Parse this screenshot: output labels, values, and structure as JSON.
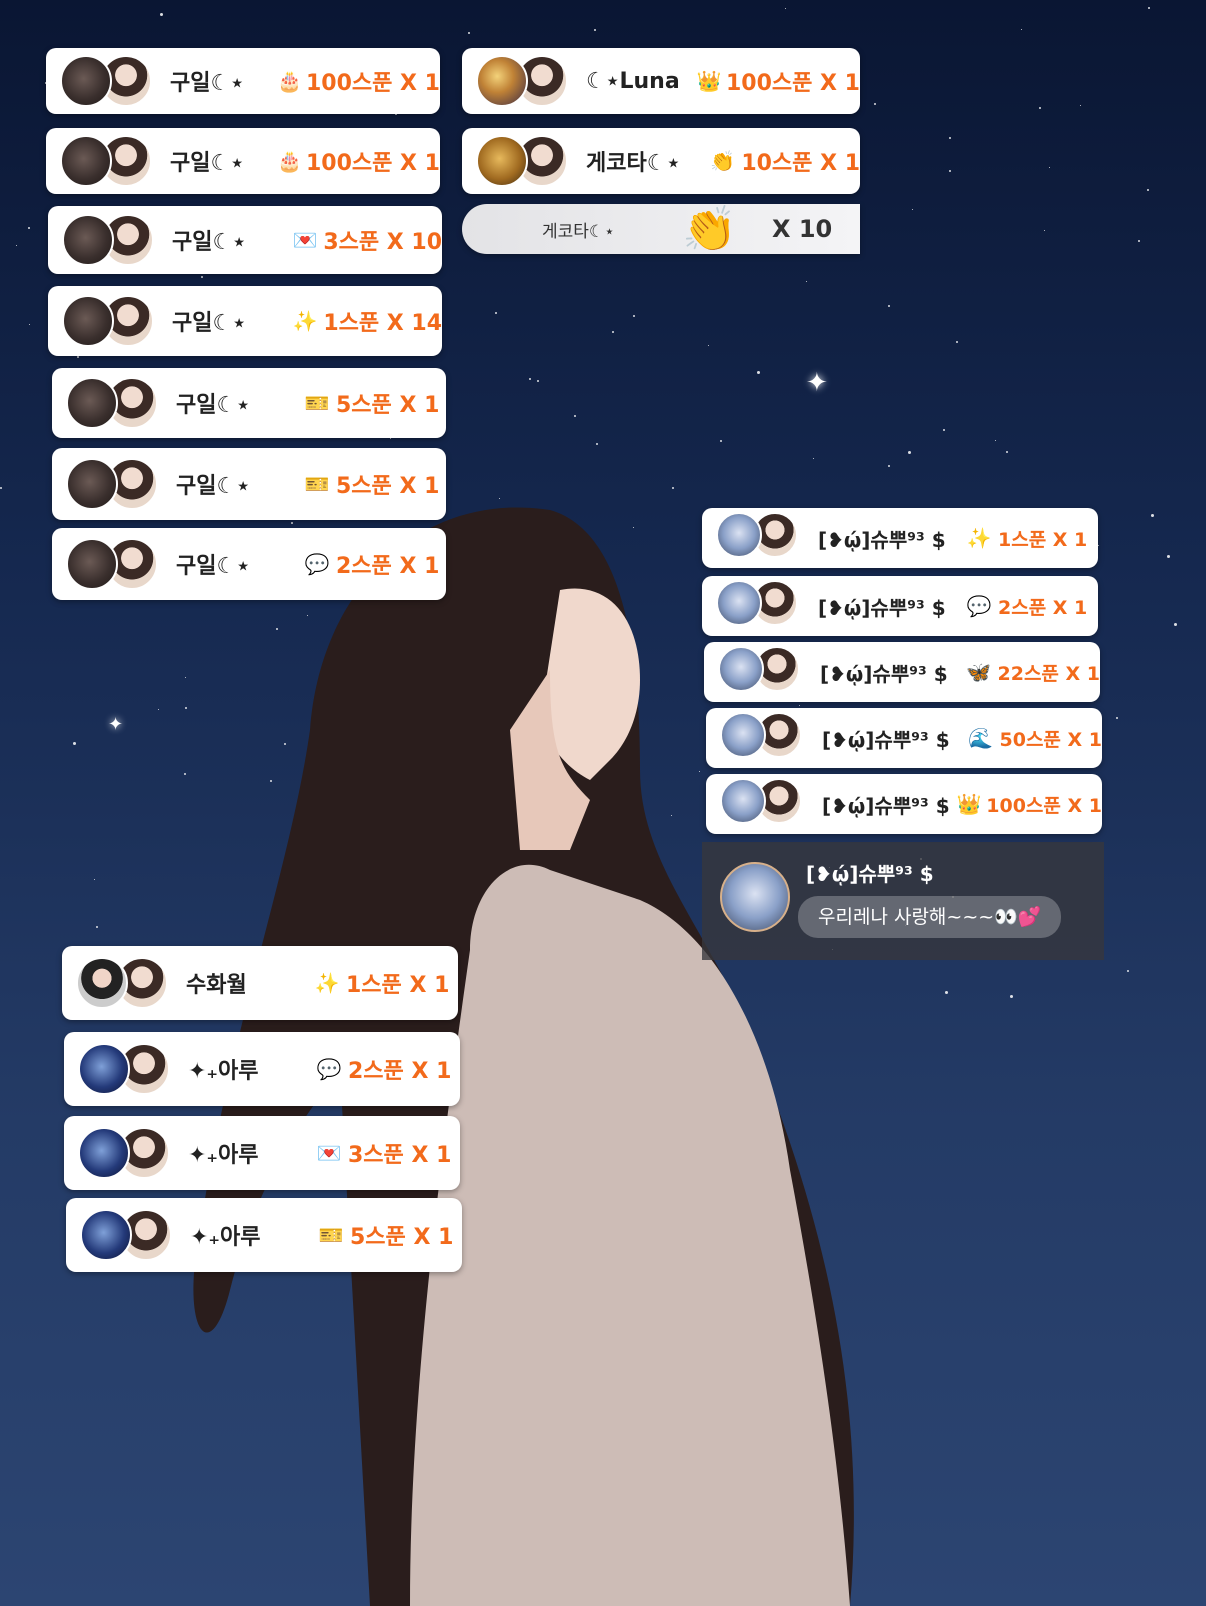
{
  "left_gifts": [
    {
      "name": "구일☾⋆",
      "icon": "cake-icon",
      "gift": "100스푼 X 1",
      "av": "dark"
    },
    {
      "name": "구일☾⋆",
      "icon": "cake-icon",
      "gift": "100스푼 X 1",
      "av": "dark"
    },
    {
      "name": "구일☾⋆",
      "icon": "envelope-icon",
      "gift": "3스푼 X 10",
      "av": "dark"
    },
    {
      "name": "구일☾⋆",
      "icon": "stars-icon",
      "gift": "1스푼 X 14",
      "av": "dark"
    },
    {
      "name": "구일☾⋆",
      "icon": "card-icon",
      "gift": "5스푼 X 1",
      "av": "dark"
    },
    {
      "name": "구일☾⋆",
      "icon": "card-icon",
      "gift": "5스푼 X 1",
      "av": "dark"
    },
    {
      "name": "구일☾⋆",
      "icon": "speech-icon",
      "gift": "2스푼 X 1",
      "av": "dark"
    }
  ],
  "middle_gifts": [
    {
      "name": "☾⋆Luna",
      "icon": "crown-icon",
      "gift": "100스푼 X 1",
      "av": "moon"
    },
    {
      "name": "게코타☾⋆",
      "icon": "clap-icon",
      "gift": "10스푼 X 1",
      "av": "gold"
    }
  ],
  "combo": {
    "name": "게코타☾⋆",
    "count": "X 10"
  },
  "right_gifts": [
    {
      "name": "[❥ῴ]슈뿌⁹³ $",
      "icon": "stars-icon",
      "gift": "1스푼 X 1"
    },
    {
      "name": "[❥ῴ]슈뿌⁹³ $",
      "icon": "speech-icon",
      "gift": "2스푼 X 1"
    },
    {
      "name": "[❥ῴ]슈뿌⁹³ $",
      "icon": "butterfly-icon",
      "gift": "22스푼 X 1"
    },
    {
      "name": "[❥ῴ]슈뿌⁹³ $",
      "icon": "wave-icon",
      "gift": "50스푼 X 1"
    },
    {
      "name": "[❥ῴ]슈뿌⁹³ $",
      "icon": "crown-icon",
      "gift": "100스푼 X 1"
    }
  ],
  "chat": {
    "name": "[❥ῴ]슈뿌⁹³ $",
    "message": "우리레나 사랑해~~~👀💕"
  },
  "bottom_gifts": [
    {
      "name": "수화월",
      "icon": "stars-icon",
      "gift": "1스푼 X 1",
      "av": "boy"
    },
    {
      "name": "✦₊아루",
      "icon": "speech-icon",
      "gift": "2스푼 X 1",
      "av": "club"
    },
    {
      "name": "✦₊아루",
      "icon": "envelope-icon",
      "gift": "3스푼 X 1",
      "av": "club"
    },
    {
      "name": "✦₊아루",
      "icon": "card-icon",
      "gift": "5스푼 X 1",
      "av": "club"
    }
  ],
  "icons": {
    "cake-icon": "🎂",
    "envelope-icon": "💌",
    "stars-icon": "✨",
    "card-icon": "🎫",
    "speech-icon": "💬",
    "crown-icon": "👑",
    "clap-icon": "👏",
    "butterfly-icon": "🦋",
    "wave-icon": "🌊"
  }
}
